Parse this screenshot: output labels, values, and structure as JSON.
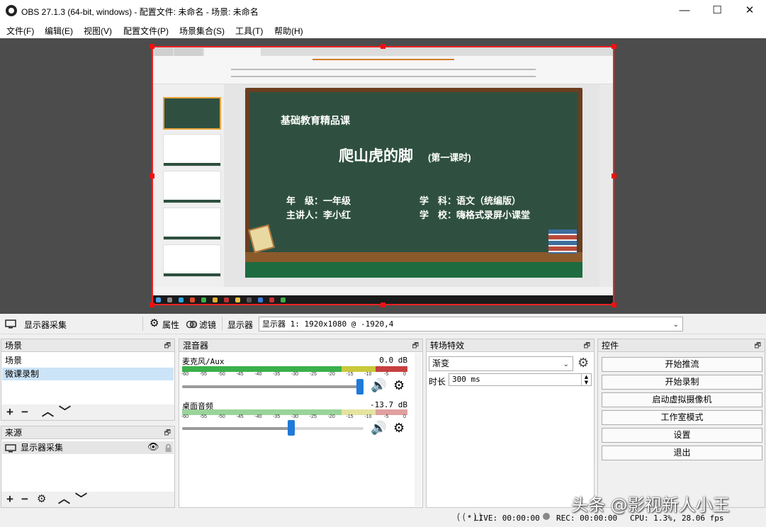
{
  "window": {
    "title": "OBS 27.1.3 (64-bit, windows) - 配置文件: 未命名 - 场景: 未命名",
    "minimize": "—",
    "maximize": "☐",
    "close": "✕"
  },
  "menu": [
    "文件(F)",
    "编辑(E)",
    "视图(V)",
    "配置文件(P)",
    "场景集合(S)",
    "工具(T)",
    "帮助(H)"
  ],
  "preview": {
    "board": {
      "header": "基础教育精品课",
      "title": "爬山虎的脚",
      "title_suffix": "(第一课时)",
      "grade_label": "年　级：一年级",
      "subject_label": "学　科：语文（统编版）",
      "speaker_label": "主讲人：李小红",
      "school_label": "学　校：嗨格式录屏小课堂"
    }
  },
  "source_toolbar": {
    "source_name": "显示器采集",
    "properties": "属性",
    "filters": "滤镜",
    "display_label": "显示器",
    "display_value": "显示器 1: 1920x1080 @ -1920,4"
  },
  "scenes": {
    "title": "场景",
    "items": [
      "场景",
      "微课录制"
    ],
    "selected": "微课录制"
  },
  "sources": {
    "title": "来源",
    "items": [
      "显示器采集"
    ]
  },
  "mixer": {
    "title": "混音器",
    "channels": [
      {
        "name": "麦克风/Aux",
        "db": "0.0 dB",
        "volume_fraction": 0.98
      },
      {
        "name": "桌面音频",
        "db": "-13.7 dB",
        "volume_fraction": 0.6
      }
    ],
    "scale": [
      "-60",
      "-55",
      "-50",
      "-45",
      "-40",
      "-35",
      "-30",
      "-25",
      "-20",
      "-15",
      "-10",
      "-5",
      "0"
    ]
  },
  "transitions": {
    "title": "转场特效",
    "selected": "渐变",
    "duration_label": "时长",
    "duration_value": "300 ms"
  },
  "controls": {
    "title": "控件",
    "buttons": [
      "开始推流",
      "开始录制",
      "启动虚拟摄像机",
      "工作室模式",
      "设置",
      "退出"
    ]
  },
  "status": {
    "live": "LIVE: 00:00:00",
    "rec": "REC: 00:00:00",
    "cpu": "CPU: 1.3%, 28.06 fps"
  },
  "watermark": "头条 @影视新人小王",
  "colors": {
    "accent": "#1f7ad8",
    "selection": "#cce4f7",
    "capture_border": "#e22222",
    "board": "#2f5040"
  }
}
